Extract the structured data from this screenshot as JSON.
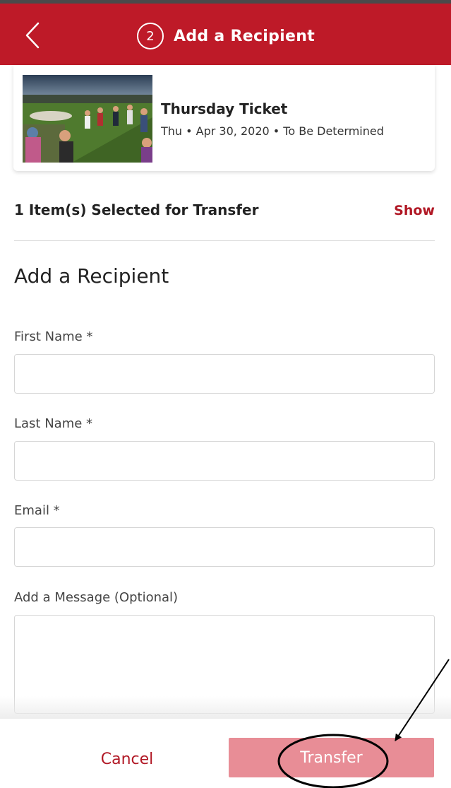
{
  "header": {
    "step_number": "2",
    "title": "Add a Recipient"
  },
  "ticket": {
    "title": "Thursday Ticket",
    "details": "Thu • Apr 30, 2020 • To Be Determined"
  },
  "selection": {
    "summary": "1 Item(s) Selected for Transfer",
    "show_label": "Show"
  },
  "form": {
    "section_title": "Add a Recipient",
    "first_name_label": "First Name *",
    "first_name_value": "",
    "last_name_label": "Last Name *",
    "last_name_value": "",
    "email_label": "Email *",
    "email_value": "",
    "message_label": "Add a Message (Optional)",
    "message_value": ""
  },
  "footer": {
    "cancel_label": "Cancel",
    "transfer_label": "Transfer"
  },
  "colors": {
    "brand_red": "#be1a28",
    "link_red": "#b11825",
    "transfer_disabled": "#e88d96"
  },
  "icons": [
    "chevron-left-icon"
  ]
}
